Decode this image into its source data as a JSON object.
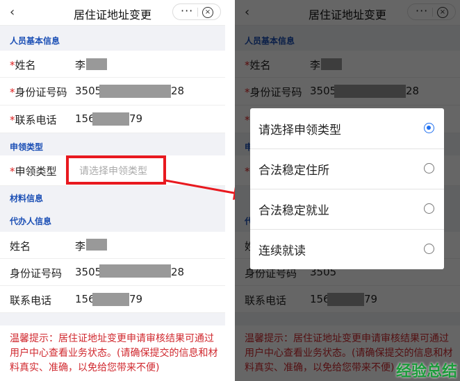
{
  "left": {
    "header": {
      "back": "‹",
      "title": "居住证地址变更",
      "more": "···",
      "close": "×"
    },
    "sections": {
      "basic": "人员基本信息",
      "apply": "申领类型",
      "material": "材料信息",
      "agent": "代办人信息"
    },
    "basic_rows": [
      {
        "star": "*",
        "label": "姓名",
        "value": "李"
      },
      {
        "star": "*",
        "label": "身份证号码",
        "value_start": "3505",
        "value_end": "28"
      },
      {
        "star": "*",
        "label": "联系电话",
        "value_start": "156",
        "value_end": "79"
      }
    ],
    "apply_row": {
      "star": "*",
      "label": "申领类型",
      "placeholder": "请选择申领类型"
    },
    "agent_rows": [
      {
        "label": "姓名",
        "value": "李"
      },
      {
        "label": "身份证号码",
        "value_start": "3505",
        "value_end": "28"
      },
      {
        "label": "联系电话",
        "value_start": "156",
        "value_end": "79"
      }
    ],
    "tip": "温馨提示：居住证地址变更申请审核结果可通过用户中心查看业务状态。(请确保提交的信息和材料真实、准确，以免给您带来不便)"
  },
  "right": {
    "options": [
      {
        "label": "请选择申领类型",
        "selected": true
      },
      {
        "label": "合法稳定住所",
        "selected": false
      },
      {
        "label": "合法稳定就业",
        "selected": false
      },
      {
        "label": "连续就读",
        "selected": false
      }
    ],
    "watermark": "经验总结"
  },
  "colors": {
    "accent_red": "#e8191f",
    "section_blue": "#1b4fb5",
    "radio_blue": "#1e6ff0",
    "tip_red": "#d0282e"
  }
}
